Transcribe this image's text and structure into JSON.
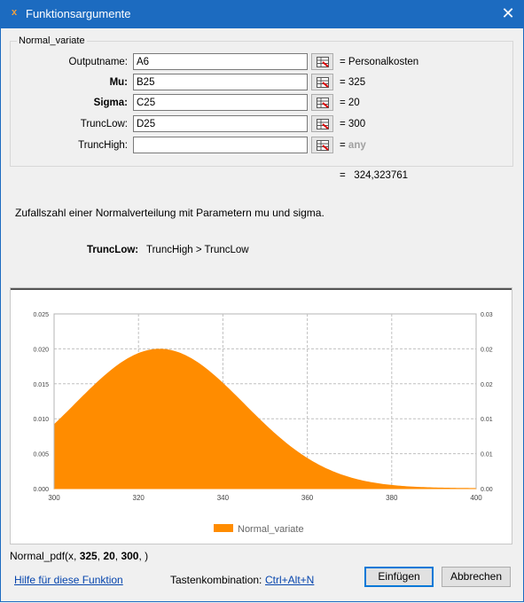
{
  "window": {
    "title": "Funktionsargumente",
    "app_icon_glyph": "x",
    "close_glyph": "✕"
  },
  "group": {
    "label": "Normal_variate"
  },
  "args": [
    {
      "label": "Outputname:",
      "value": "A6",
      "result": "= Personalkosten",
      "bold": false
    },
    {
      "label": "Mu:",
      "value": "B25",
      "result": "= 325",
      "bold": true
    },
    {
      "label": "Sigma:",
      "value": "C25",
      "result": "= 20",
      "bold": true
    },
    {
      "label": "TruncLow:",
      "value": "D25",
      "result": "= 300",
      "bold": false
    },
    {
      "label": "TruncHigh:",
      "value": "",
      "result": "= ",
      "result_any": "any",
      "bold": false
    }
  ],
  "result": "=   324,323761",
  "description": "Zufallszahl einer Normalverteilung mit Parametern mu und sigma.",
  "current_arg": {
    "name": "TruncLow:",
    "description": "TruncHigh > TruncLow"
  },
  "chart_data": {
    "type": "area",
    "title": "",
    "x_ticks": [
      300,
      320,
      340,
      360,
      380,
      400
    ],
    "y_ticks_left": [
      "0.000",
      "0.005",
      "0.010",
      "0.015",
      "0.020",
      "0.025"
    ],
    "y_ticks_right": [
      "0.00",
      "0.01",
      "0.01",
      "0.02",
      "0.02",
      "0.03"
    ],
    "xlim": [
      300,
      400
    ],
    "ylim": [
      0,
      0.025
    ],
    "grid": true,
    "legend": "bottom",
    "series": [
      {
        "name": "Normal_variate",
        "type": "normal_pdf",
        "mu": 325,
        "sigma": 20,
        "trunc_low": 300,
        "color": "#ff8c00"
      }
    ]
  },
  "formula": {
    "prefix": "Normal_pdf(x, ",
    "mu": "325",
    "sep1": ", ",
    "sigma": "20",
    "sep2": ", ",
    "trunclow": "300",
    "suffix": ", )"
  },
  "footer": {
    "help_link": "Hilfe für diese Funktion",
    "shortcut_label": "Tastenkombination:",
    "shortcut_value": "Ctrl+Alt+N",
    "insert_button": "Einfügen",
    "cancel_button": "Abbrechen"
  }
}
